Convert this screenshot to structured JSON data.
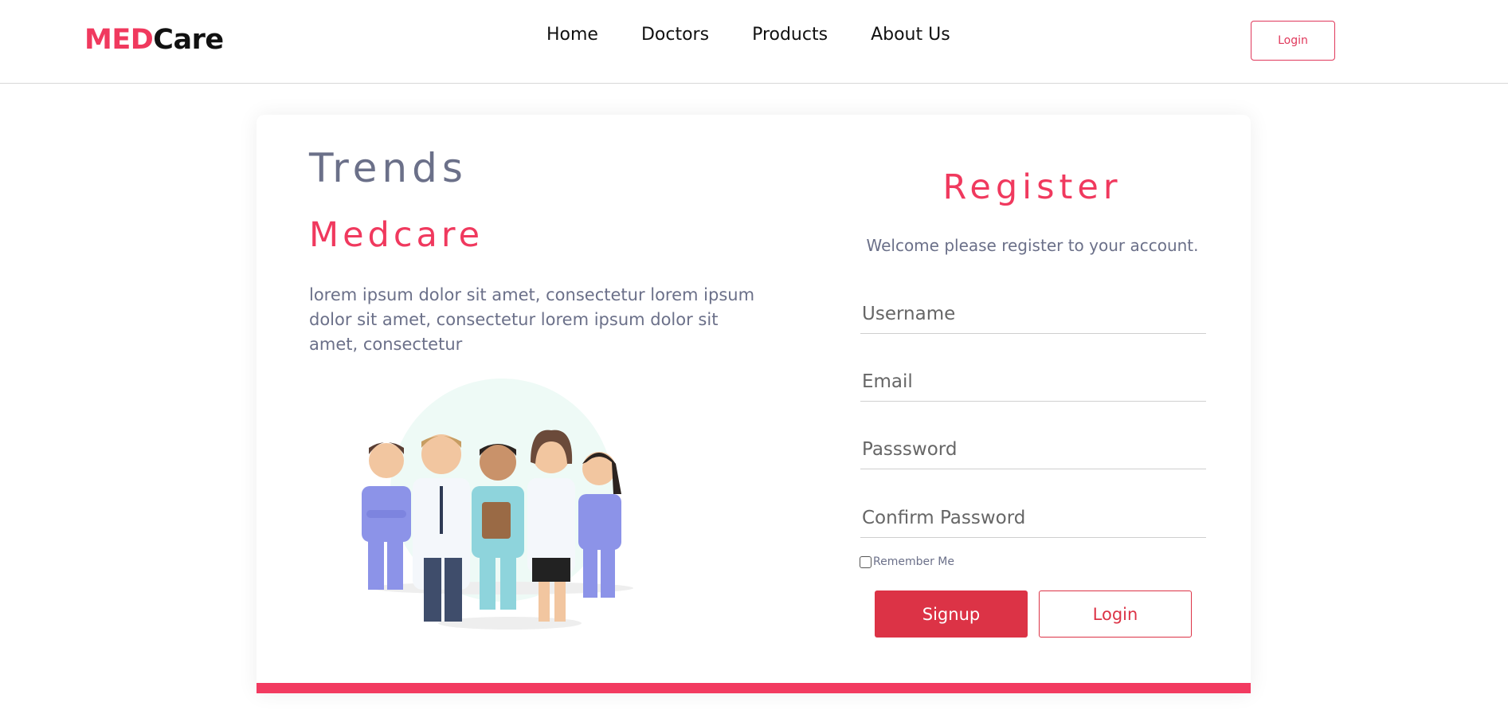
{
  "brand": {
    "logo_part1": "MED",
    "logo_part2": "Care"
  },
  "nav": {
    "items": [
      {
        "label": "Home"
      },
      {
        "label": "Doctors"
      },
      {
        "label": "Products"
      },
      {
        "label": "About Us"
      }
    ],
    "login_label": "Login"
  },
  "hero": {
    "title": "Trends",
    "subtitle": "Medcare",
    "description": "lorem ipsum dolor sit amet, consectetur lorem ipsum dolor sit amet, consectetur lorem ipsum dolor sit amet, consectetur",
    "illustration_icon": "doctors-group-illustration"
  },
  "register": {
    "title": "Register",
    "welcome": "Welcome please register to your account.",
    "fields": [
      {
        "placeholder": "Username",
        "value": ""
      },
      {
        "placeholder": "Email",
        "value": ""
      },
      {
        "placeholder": "Passsword",
        "value": ""
      },
      {
        "placeholder": "Confirm Password",
        "value": ""
      }
    ],
    "remember_label": "Remember Me",
    "remember_checked": false,
    "signup_label": "Signup",
    "login_label": "Login"
  },
  "colors": {
    "accent": "#f0395e",
    "button_red": "#dc3346",
    "muted_text": "#6b7089"
  }
}
